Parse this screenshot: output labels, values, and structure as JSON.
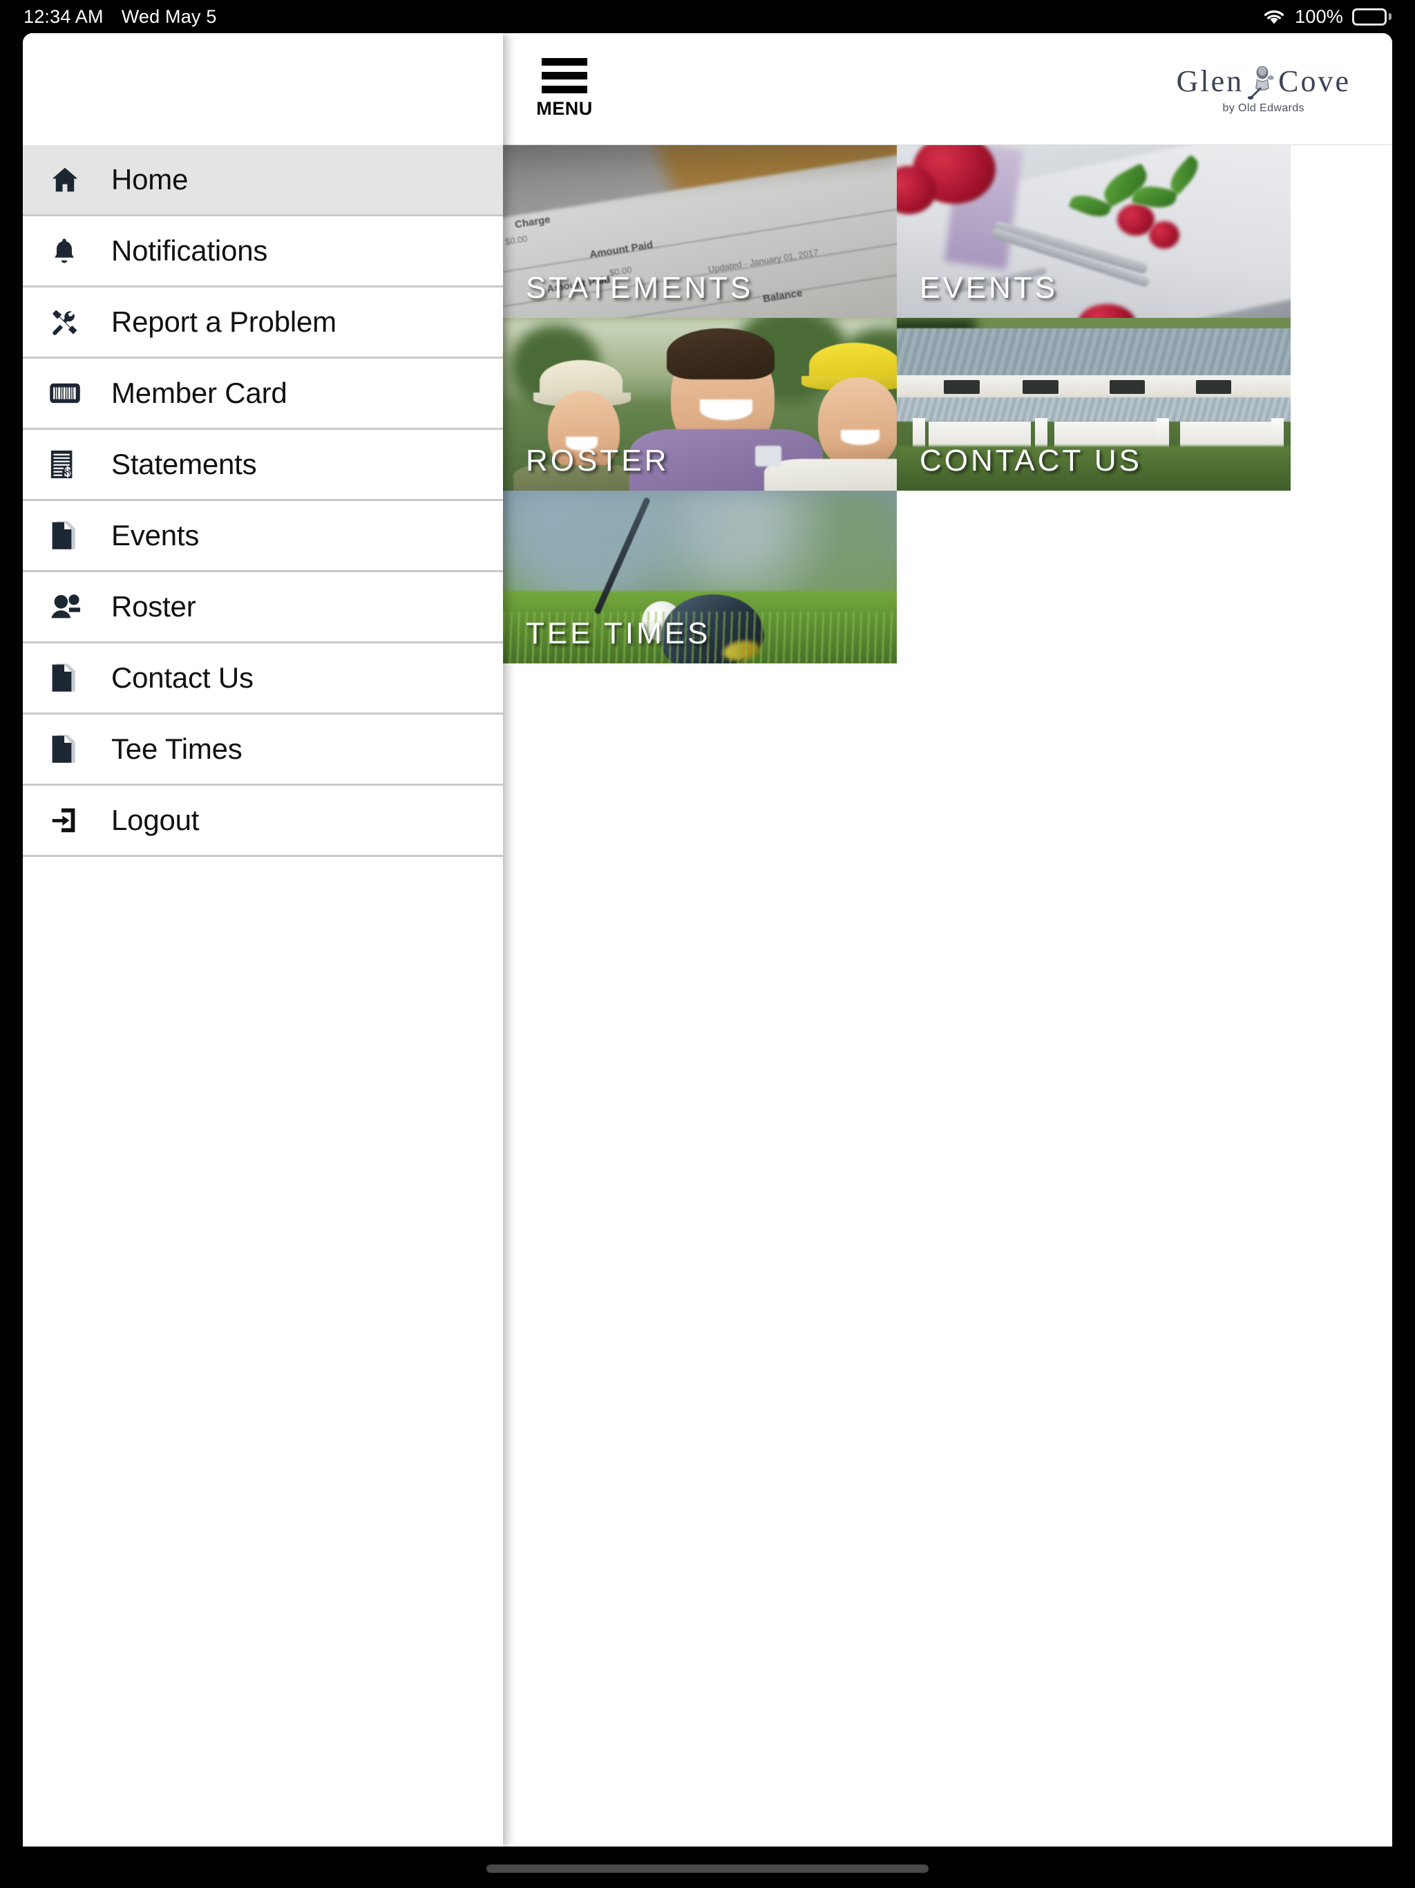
{
  "status_bar": {
    "time": "12:34 AM",
    "date": "Wed May 5",
    "battery_percent": "100%",
    "wifi_icon": "wifi-icon",
    "battery_icon": "battery-full-icon"
  },
  "topbar": {
    "menu_label": "MENU",
    "menu_icon": "hamburger-icon",
    "brand": {
      "word_left": "Glen",
      "word_right": "Cove",
      "tagline": "by Old Edwards",
      "crest_icon": "crest-icon",
      "color": "#3d4355"
    }
  },
  "sidebar": {
    "active_index": 0,
    "items": [
      {
        "label": "Home",
        "icon": "home-icon",
        "active": true
      },
      {
        "label": "Notifications",
        "icon": "bell-icon",
        "active": false
      },
      {
        "label": "Report a Problem",
        "icon": "tools-icon",
        "active": false
      },
      {
        "label": "Member Card",
        "icon": "barcode-icon",
        "active": false
      },
      {
        "label": "Statements",
        "icon": "invoice-dollar-icon",
        "active": false
      },
      {
        "label": "Events",
        "icon": "documents-icon",
        "active": false
      },
      {
        "label": "Roster",
        "icon": "people-icon",
        "active": false
      },
      {
        "label": "Contact Us",
        "icon": "documents-icon",
        "active": false
      },
      {
        "label": "Tee Times",
        "icon": "documents-icon",
        "active": false
      },
      {
        "label": "Logout",
        "icon": "logout-icon",
        "active": false
      }
    ]
  },
  "main": {
    "tiles": [
      {
        "label": "STATEMENTS",
        "art": "statements-photo"
      },
      {
        "label": "EVENTS",
        "art": "events-photo"
      },
      {
        "label": "ROSTER",
        "art": "roster-photo"
      },
      {
        "label": "CONTACT US",
        "art": "contact-photo"
      },
      {
        "label": "TEE TIMES",
        "art": "tee-times-photo"
      }
    ],
    "statements_art_text": {
      "charge": "Charge",
      "amount_paid": "Amount Paid",
      "amount_paid_2": "Amount Paid",
      "zero_1": "$0.00",
      "zero_2": "$0.00",
      "updated": "Updated - January 01, 2017",
      "balance": "Balance"
    }
  }
}
